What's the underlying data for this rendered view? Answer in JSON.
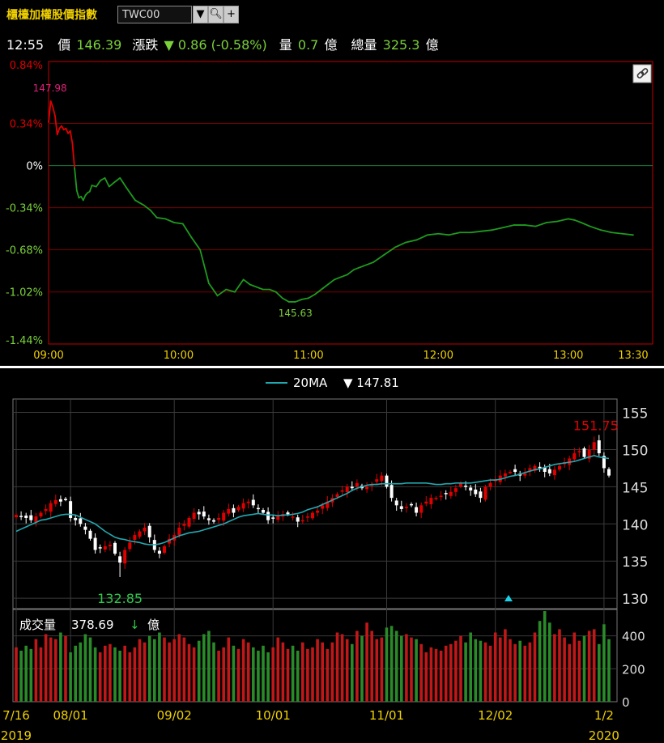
{
  "header": {
    "title": "櫃檯加權股價指數",
    "symbol": "TWC00",
    "time": "12:55",
    "price_label": "價",
    "price": "146.39",
    "change_label": "漲跌",
    "change": "▼ 0.86 (-0.58%)",
    "volume_label": "量",
    "volume": "0.7",
    "volume_unit": "億",
    "total_volume_label": "總量",
    "total_volume": "325.3",
    "total_volume_unit": "億"
  },
  "chart_data": [
    {
      "type": "line",
      "y_tick_labels": [
        "0.84%",
        "0.34%",
        "0%",
        "-0.34%",
        "-0.68%",
        "-1.02%",
        "-1.44%"
      ],
      "y_tick_values": [
        0.84,
        0.34,
        0,
        -0.34,
        -0.68,
        -1.02,
        -1.44
      ],
      "x_tick_labels": [
        "09:00",
        "10:00",
        "11:00",
        "12:00",
        "13:00",
        "13:30"
      ],
      "x_tick_minutes": [
        0,
        60,
        120,
        180,
        240,
        270
      ],
      "annotations": [
        {
          "text": "147.98"
        },
        {
          "text": "145.63"
        }
      ],
      "colors": {
        "up": "#e00000",
        "down": "#1f9a1f"
      },
      "series": [
        {
          "x": [
            0,
            1,
            2,
            3,
            4,
            5,
            6,
            7,
            8,
            9,
            10,
            11,
            12,
            13,
            14,
            15,
            16,
            17,
            18,
            19,
            20,
            22,
            24,
            26,
            28,
            30,
            33,
            36,
            40,
            44,
            47,
            50,
            54,
            58,
            62,
            66,
            70,
            74,
            78,
            82,
            86,
            90,
            93,
            96,
            99,
            102,
            105,
            108,
            111,
            114,
            117,
            120,
            123,
            126,
            129,
            132,
            135,
            138,
            141,
            144,
            147,
            150,
            155,
            160,
            165,
            170,
            175,
            180,
            185,
            190,
            195,
            200,
            205,
            210,
            215,
            220,
            225,
            230,
            235,
            240,
            243,
            246,
            250,
            255,
            260,
            265,
            270
          ],
          "y": [
            0.35,
            0.52,
            0.47,
            0.4,
            0.25,
            0.3,
            0.32,
            0.29,
            0.3,
            0.26,
            0.28,
            0.18,
            -0.02,
            -0.2,
            -0.26,
            -0.25,
            -0.28,
            -0.24,
            -0.22,
            -0.21,
            -0.16,
            -0.17,
            -0.12,
            -0.1,
            -0.17,
            -0.14,
            -0.1,
            -0.18,
            -0.28,
            -0.32,
            -0.36,
            -0.42,
            -0.43,
            -0.46,
            -0.47,
            -0.58,
            -0.68,
            -0.95,
            -1.05,
            -1.0,
            -1.02,
            -0.92,
            -0.96,
            -0.98,
            -1.0,
            -1.0,
            -1.02,
            -1.07,
            -1.1,
            -1.1,
            -1.08,
            -1.07,
            -1.04,
            -1.0,
            -0.96,
            -0.92,
            -0.9,
            -0.88,
            -0.84,
            -0.82,
            -0.8,
            -0.78,
            -0.72,
            -0.66,
            -0.62,
            -0.6,
            -0.56,
            -0.55,
            -0.56,
            -0.54,
            -0.54,
            -0.53,
            -0.52,
            -0.5,
            -0.48,
            -0.48,
            -0.49,
            -0.46,
            -0.45,
            -0.43,
            -0.44,
            -0.46,
            -0.49,
            -0.52,
            -0.54,
            -0.55,
            -0.56
          ]
        }
      ]
    },
    {
      "type": "candlestick",
      "legend": "20MA",
      "legend_value": "▼ 147.81",
      "y_tick_labels": [
        "155",
        "150",
        "145",
        "140",
        "135",
        "130"
      ],
      "y_tick_values": [
        155,
        150,
        145,
        140,
        135,
        130
      ],
      "ylim": [
        128.6,
        156.8
      ],
      "x_tick_labels": [
        "7/16\n2019",
        "08/01",
        "09/02",
        "10/01",
        "11/01",
        "12/02",
        "1/2\n2020"
      ],
      "x_tick_index": [
        0,
        11,
        32,
        52,
        75,
        97,
        119
      ],
      "annotations": [
        {
          "text": "151.75"
        },
        {
          "text": "132.85"
        }
      ],
      "colors": {
        "up": "#e00000",
        "down": "#ffffff",
        "ma": "#22a8b0"
      },
      "closes": [
        141.2,
        141.0,
        140.8,
        140.5,
        141.0,
        141.5,
        142.0,
        142.8,
        143.2,
        143.0,
        143.3,
        140.8,
        140.5,
        140.0,
        139.2,
        138.0,
        136.5,
        136.8,
        137.0,
        137.2,
        136.0,
        134.8,
        136.5,
        137.5,
        138.5,
        139.0,
        139.5,
        138.2,
        136.5,
        136.0,
        137.0,
        138.0,
        138.5,
        139.5,
        140.0,
        140.8,
        141.5,
        141.3,
        141.0,
        140.5,
        140.3,
        140.8,
        141.5,
        142.0,
        141.5,
        142.3,
        142.8,
        143.0,
        142.5,
        142.0,
        141.5,
        140.5,
        140.8,
        141.0,
        141.3,
        141.3,
        141.0,
        140.3,
        140.5,
        141.0,
        141.5,
        141.8,
        142.5,
        143.0,
        143.5,
        144.0,
        144.5,
        145.0,
        144.8,
        145.5,
        144.8,
        145.0,
        145.3,
        146.0,
        146.5,
        145.0,
        143.5,
        142.5,
        142.0,
        142.3,
        142.5,
        141.5,
        142.5,
        143.0,
        143.5,
        143.5,
        143.8,
        144.0,
        144.3,
        144.8,
        145.5,
        145.0,
        144.5,
        144.0,
        143.5,
        145.0,
        145.5,
        146.0,
        146.5,
        146.8,
        147.0,
        147.0,
        146.5,
        146.8,
        147.5,
        147.8,
        147.5,
        147.0,
        146.8,
        147.3,
        147.8,
        148.3,
        148.8,
        149.5,
        149.8,
        149.0,
        150.0,
        151.0,
        149.5,
        147.5,
        146.5
      ],
      "ma20": [
        139.0,
        139.3,
        139.6,
        139.9,
        140.2,
        140.5,
        140.6,
        140.8,
        141.0,
        141.2,
        141.3,
        141.3,
        141.2,
        140.9,
        140.6,
        140.3,
        140.0,
        139.5,
        139.0,
        138.6,
        138.2,
        138.0,
        137.9,
        137.7,
        137.6,
        137.5,
        137.3,
        137.2,
        137.2,
        137.3,
        137.5,
        137.8,
        138.1,
        138.4,
        138.6,
        138.8,
        138.9,
        139.0,
        139.2,
        139.4,
        139.6,
        139.8,
        140.0,
        140.3,
        140.6,
        140.9,
        141.1,
        141.2,
        141.3,
        141.4,
        141.3,
        141.2,
        141.2,
        141.1,
        141.2,
        141.2,
        141.3,
        141.4,
        141.6,
        141.9,
        142.1,
        142.3,
        142.6,
        142.9,
        143.2,
        143.5,
        143.8,
        144.1,
        144.5,
        144.8,
        145.0,
        145.2,
        145.3,
        145.3,
        145.4,
        145.4,
        145.4,
        145.4,
        145.4,
        145.5,
        145.5,
        145.5,
        145.5,
        145.5,
        145.4,
        145.3,
        145.3,
        145.4,
        145.4,
        145.5,
        145.5,
        145.5,
        145.5,
        145.6,
        145.7,
        145.8,
        145.9,
        145.9,
        146.0,
        146.2,
        146.4,
        146.5,
        146.7,
        146.9,
        147.1,
        147.3,
        147.4,
        147.6,
        147.8,
        148.0,
        148.1,
        148.2,
        148.3,
        148.4,
        148.6,
        148.8,
        149.0,
        149.2,
        149.0,
        148.9,
        148.8
      ]
    },
    {
      "type": "bar",
      "label": "成交量",
      "label_value": "378.69",
      "label_arrow": "↓",
      "label_unit": "億",
      "y_tick_labels": [
        "400",
        "200",
        "0"
      ],
      "y_tick_values": [
        400,
        200,
        0
      ],
      "ylim": [
        0,
        560
      ],
      "values": [
        330,
        310,
        340,
        320,
        380,
        330,
        410,
        390,
        380,
        420,
        400,
        300,
        340,
        360,
        410,
        390,
        330,
        300,
        340,
        350,
        330,
        310,
        340,
        300,
        330,
        380,
        360,
        400,
        380,
        420,
        390,
        360,
        380,
        410,
        390,
        350,
        330,
        370,
        410,
        430,
        360,
        310,
        330,
        390,
        340,
        320,
        380,
        360,
        330,
        310,
        340,
        300,
        330,
        390,
        360,
        320,
        340,
        310,
        360,
        320,
        330,
        380,
        360,
        320,
        360,
        420,
        410,
        380,
        350,
        430,
        400,
        480,
        430,
        380,
        390,
        450,
        460,
        430,
        400,
        410,
        390,
        380,
        350,
        300,
        330,
        320,
        310,
        340,
        350,
        370,
        400,
        360,
        420,
        380,
        370,
        360,
        340,
        420,
        390,
        440,
        380,
        350,
        370,
        340,
        360,
        420,
        490,
        550,
        480,
        410,
        440,
        390,
        350,
        420,
        370,
        400,
        430,
        440,
        350,
        470,
        380,
        380
      ]
    }
  ]
}
